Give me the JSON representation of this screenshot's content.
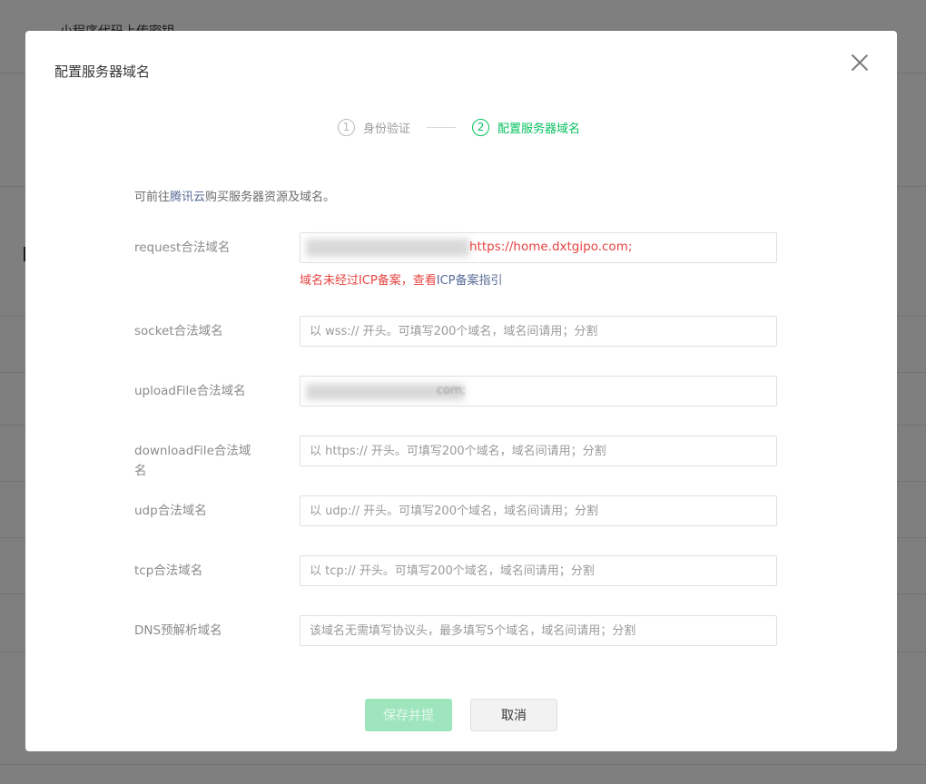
{
  "background": {
    "page_title": "小程序代码上传密钥"
  },
  "dialog": {
    "title": "配置服务器域名",
    "close_icon": "close-icon"
  },
  "steps": [
    {
      "num": "1",
      "label": "身份验证",
      "active": false
    },
    {
      "num": "2",
      "label": "配置服务器域名",
      "active": true
    }
  ],
  "tip": {
    "prefix": "可前往",
    "link": "腾讯云",
    "suffix": "购买服务器资源及域名。"
  },
  "fields": {
    "request": {
      "label": "request合法域名",
      "value": "https://home.dxtgipo.com;"
    },
    "request_error": {
      "text": "域名未经过ICP备案，查看",
      "link": "ICP备案指引"
    },
    "socket": {
      "label": "socket合法域名",
      "placeholder": "以 wss:// 开头。可填写200个域名，域名间请用；分割"
    },
    "uploadFile": {
      "label": "uploadFile合法域名",
      "value": "com;"
    },
    "downloadFile": {
      "label": "downloadFile合法域名",
      "placeholder": "以 https:// 开头。可填写200个域名，域名间请用；分割"
    },
    "udp": {
      "label": "udp合法域名",
      "placeholder": "以 udp:// 开头。可填写200个域名，域名间请用；分割"
    },
    "tcp": {
      "label": "tcp合法域名",
      "placeholder": "以 tcp:// 开头。可填写200个域名，域名间请用；分割"
    },
    "dns": {
      "label": "DNS预解析域名",
      "placeholder": "该域名无需填写协议头，最多填写5个域名，域名间请用；分割"
    }
  },
  "buttons": {
    "save": "保存并提",
    "cancel": "取消"
  },
  "colors": {
    "accent": "#07c160",
    "error": "#e64340",
    "link": "#576b95",
    "save_disabled": "#9ee5bd"
  }
}
